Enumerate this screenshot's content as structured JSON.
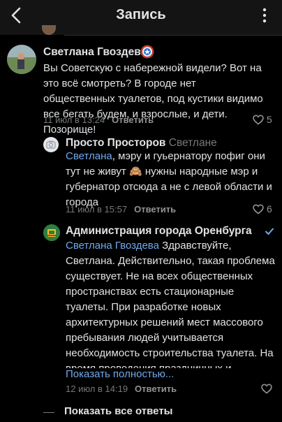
{
  "header": {
    "title": "Запись"
  },
  "comments": [
    {
      "author": "Светлана Гвоздева",
      "text": "Вы Советскую с набережной видели? Вот на это всё смотреть? В городе нет общественных туалетов, под кустики видимо все бегать будем, и взрослые, и дети. Позорище!",
      "time": "11 июл в 13:24",
      "reply_label": "Ответить",
      "likes": "5",
      "badge_icon": "captain-shield-icon"
    },
    {
      "author": "Просто Просторов",
      "reply_to": "Светлане",
      "mention": "Светлана",
      "text_a": ", мэру и гуьернатору пофиг они тут не живут",
      "emoji": "🙈",
      "text_b": " нужны народные мэр и губернатор отсюда а не с левой области и города",
      "time": "11 июл в 15:57",
      "reply_label": "Ответить",
      "likes": "6"
    },
    {
      "author": "Администрация города Оренбурга",
      "verified_icon": "verified-check-icon",
      "mention": "Светлана Гвоздева",
      "text": " Здравствуйте, Светлана. Действительно, такая проблема существует. Не на всех общественных пространствах есть стационарные туалеты. При разработке новых архитектурных решений мест массового пребывания людей учитывается необходимость строительства туалета. На время проведения праздничных и массовых м...",
      "show_more": "Показать полностью...",
      "time": "12 июл в 14:19",
      "reply_label": "Ответить"
    }
  ],
  "footer": {
    "all_replies": "Показать все ответы"
  },
  "colors": {
    "link": "#71aaeb",
    "secondary": "#76787a",
    "background": "#000000"
  }
}
